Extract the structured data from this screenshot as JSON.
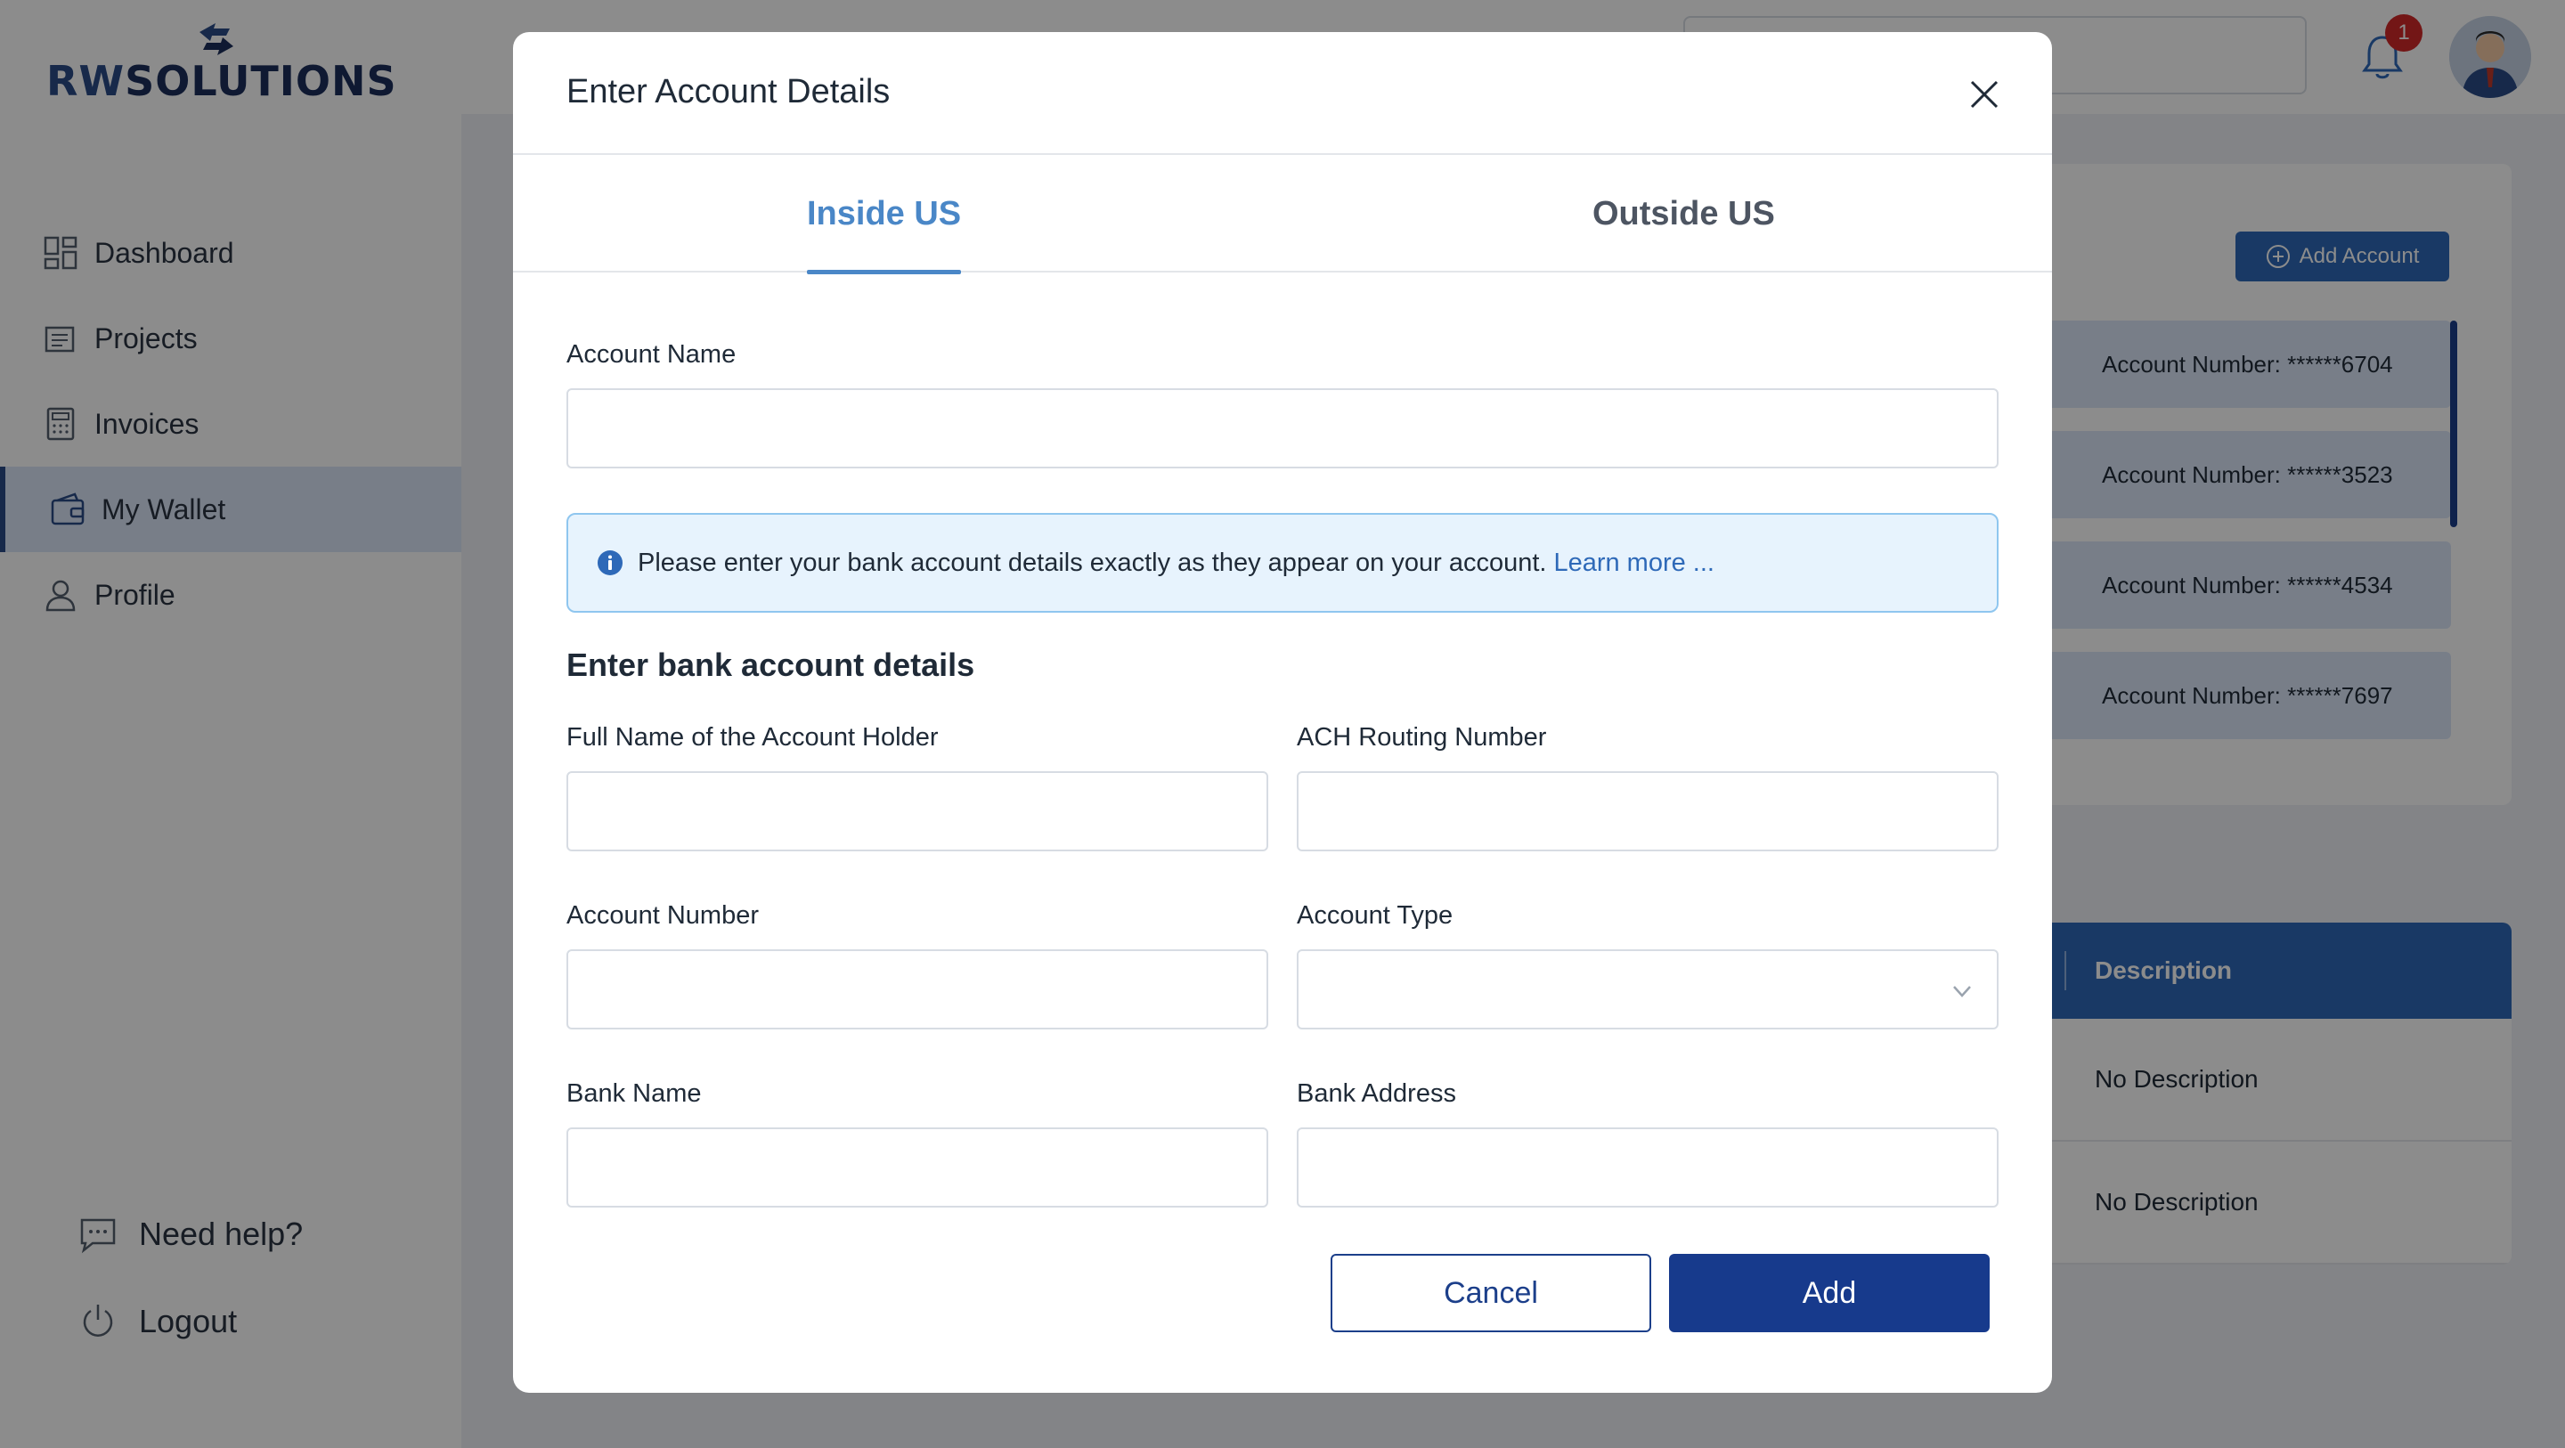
{
  "brand": {
    "logo_prefix": "RW",
    "logo_suffix": "SOLUTIONS"
  },
  "header": {
    "notification_count": "1"
  },
  "sidebar": {
    "items": [
      {
        "label": "Dashboard",
        "icon": "dashboard-icon"
      },
      {
        "label": "Projects",
        "icon": "projects-icon"
      },
      {
        "label": "Invoices",
        "icon": "invoices-icon"
      },
      {
        "label": "My Wallet",
        "icon": "wallet-icon",
        "active": true
      },
      {
        "label": "Profile",
        "icon": "profile-icon"
      }
    ],
    "help_label": "Need help?",
    "logout_label": "Logout"
  },
  "wallet": {
    "add_account_label": "Add Account",
    "accounts": [
      "Account Number: ******6704",
      "Account Number: ******3523",
      "Account Number: ******4534",
      "Account Number: ******7697"
    ],
    "table_header": "Description",
    "table_rows": [
      "No Description",
      "No Description"
    ]
  },
  "modal": {
    "title": "Enter Account Details",
    "tabs": [
      {
        "label": "Inside US",
        "active": true
      },
      {
        "label": "Outside US",
        "active": false
      }
    ],
    "account_name_label": "Account Name",
    "account_name_value": "",
    "info_text": "Please enter your bank account details exactly as they appear on your account.",
    "info_link": "Learn more ...",
    "section_title": "Enter bank account details",
    "fields": {
      "holder_label": "Full Name of the Account Holder",
      "holder_value": "",
      "routing_label": "ACH Routing Number",
      "routing_value": "",
      "account_number_label": "Account Number",
      "account_number_value": "",
      "account_type_label": "Account Type",
      "account_type_value": "",
      "bank_name_label": "Bank Name",
      "bank_name_value": "",
      "bank_address_label": "Bank Address",
      "bank_address_value": ""
    },
    "cancel_label": "Cancel",
    "add_label": "Add"
  },
  "colors": {
    "brand_dark": "#1c2f5c",
    "accent_blue": "#4a87c7",
    "primary_button": "#173a8c",
    "info_bg": "#e7f3fd"
  }
}
